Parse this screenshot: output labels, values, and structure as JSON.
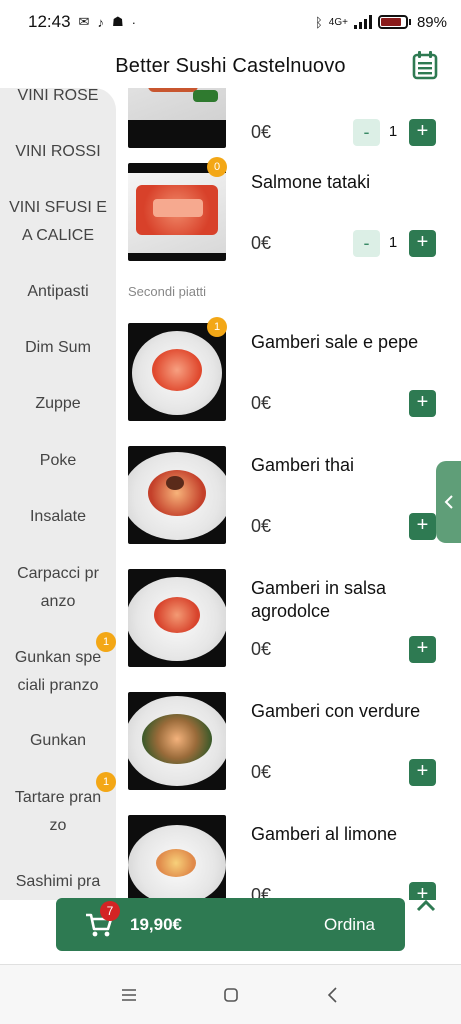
{
  "status_bar": {
    "time": "12:43",
    "battery": "89%",
    "network": "4G+",
    "icons": [
      "mail-icon",
      "music-icon",
      "ghost-icon",
      "dot-icon",
      "bluetooth-icon",
      "signal-icon",
      "battery-icon"
    ]
  },
  "header": {
    "title": "Better Sushi Castelnuovo",
    "icon": "calendar-icon"
  },
  "sidebar": {
    "categories": [
      {
        "label": "VINI ROSE",
        "badge": ""
      },
      {
        "label": "VINI ROSSI",
        "badge": ""
      },
      {
        "label": "VINI SFUSI E A CALICE",
        "badge": ""
      },
      {
        "label": "Antipasti",
        "badge": ""
      },
      {
        "label": "Dim Sum",
        "badge": ""
      },
      {
        "label": "Zuppe",
        "badge": ""
      },
      {
        "label": "Poke",
        "badge": ""
      },
      {
        "label": "Insalate",
        "badge": ""
      },
      {
        "label": "Carpacci pr anzo",
        "badge": ""
      },
      {
        "label": "Gunkan spe ciali pranzo",
        "badge": "1"
      },
      {
        "label": "Gunkan",
        "badge": ""
      },
      {
        "label": "Tartare pran zo",
        "badge": "1"
      },
      {
        "label": "Sashimi pra",
        "badge": ""
      }
    ]
  },
  "menu": {
    "items": [
      {
        "name": "",
        "price": "0€",
        "qty": "1",
        "minus": "-",
        "plus": "+",
        "badge": ""
      },
      {
        "name": "Salmone tataki",
        "price": "0€",
        "qty": "1",
        "minus": "-",
        "plus": "+",
        "badge": "0"
      },
      {
        "name": "Gamberi sale e pepe",
        "price": "0€",
        "qty": "",
        "minus": "",
        "plus": "+",
        "badge": "1"
      },
      {
        "name": "Gamberi thai",
        "price": "0€",
        "qty": "",
        "minus": "",
        "plus": "+",
        "badge": ""
      },
      {
        "name": "Gamberi in salsa agrodolce",
        "price": "0€",
        "qty": "",
        "minus": "",
        "plus": "+",
        "badge": ""
      },
      {
        "name": "Gamberi con verdure",
        "price": "0€",
        "qty": "",
        "minus": "",
        "plus": "+",
        "badge": ""
      },
      {
        "name": "Gamberi al limone",
        "price": "0€",
        "qty": "",
        "minus": "",
        "plus": "+",
        "badge": ""
      }
    ],
    "section_label": "Secondi piatti"
  },
  "cart": {
    "count": "7",
    "total": "19,90€",
    "order_label": "Ordina"
  },
  "colors": {
    "accent": "#2e7a52",
    "badge": "#f3a716",
    "cart_badge": "#d32424",
    "sidebar_bg": "#ececec",
    "minus_bg": "#dcefe6"
  }
}
